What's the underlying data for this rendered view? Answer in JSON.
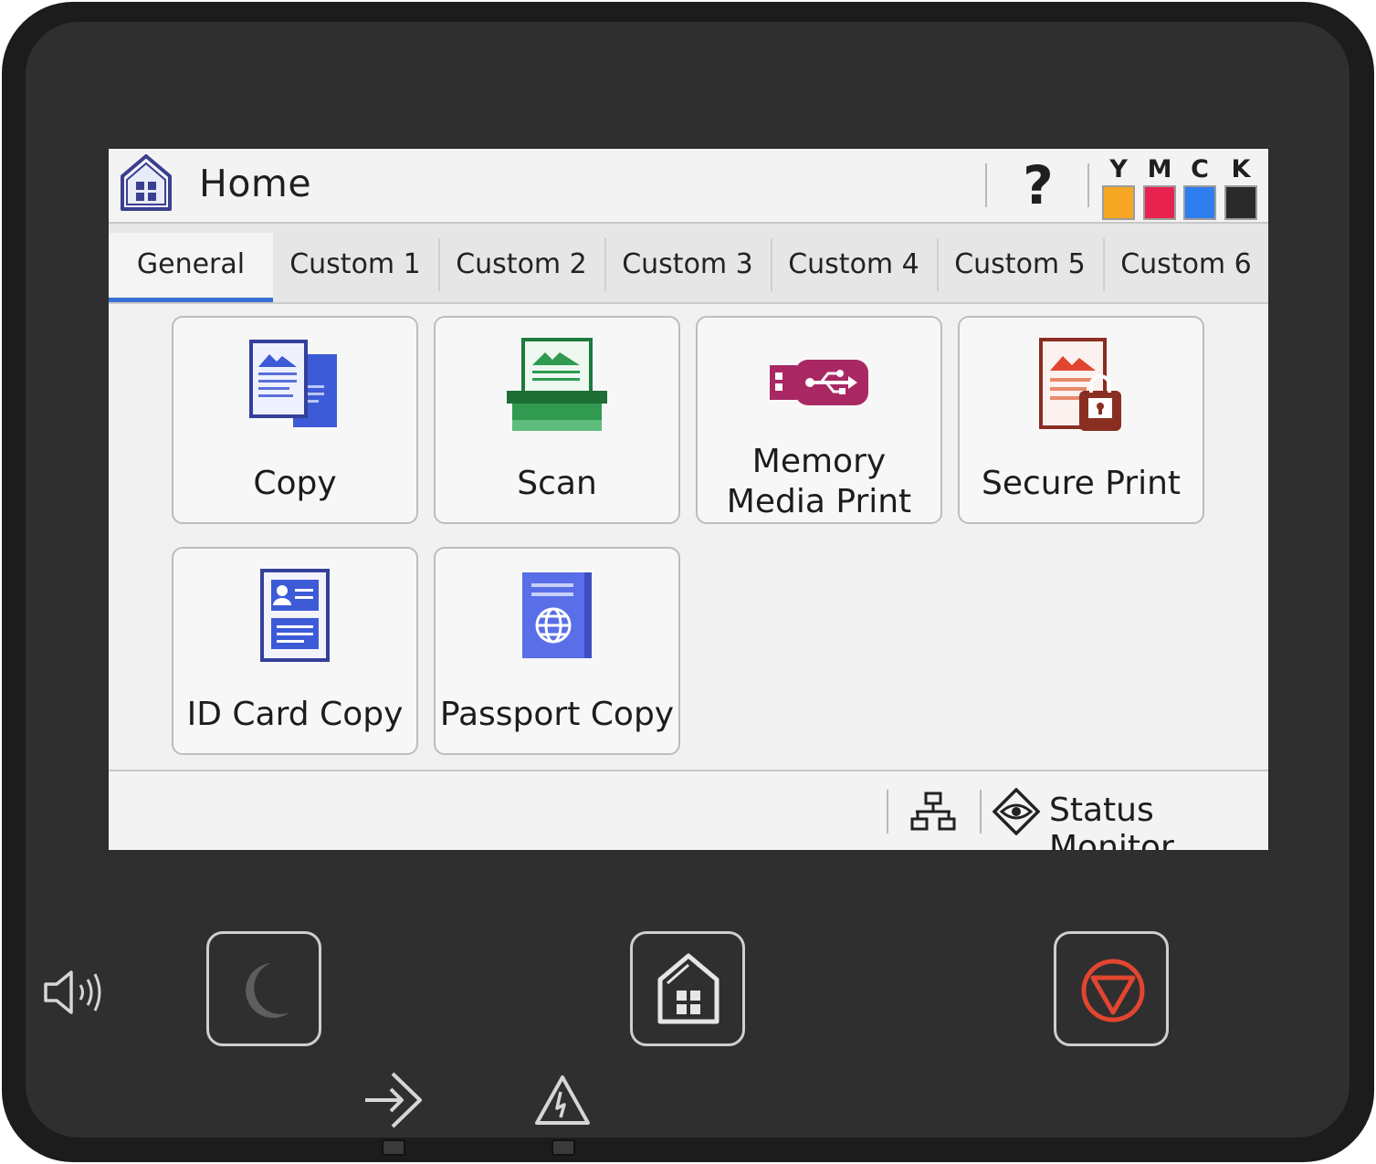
{
  "header": {
    "title": "Home",
    "help_label": "?"
  },
  "inks": [
    {
      "label": "Y",
      "color": "#f5a623"
    },
    {
      "label": "M",
      "color": "#e8224f"
    },
    {
      "label": "C",
      "color": "#2f7ef0"
    },
    {
      "label": "K",
      "color": "#2a2a2a"
    }
  ],
  "tabs": [
    {
      "label": "General",
      "active": true
    },
    {
      "label": "Custom 1"
    },
    {
      "label": "Custom 2"
    },
    {
      "label": "Custom 3"
    },
    {
      "label": "Custom 4"
    },
    {
      "label": "Custom 5"
    },
    {
      "label": "Custom 6"
    }
  ],
  "tiles": [
    {
      "label": "Copy",
      "icon": "copy-icon"
    },
    {
      "label": "Scan",
      "icon": "scan-icon"
    },
    {
      "label_line1": "Memory",
      "label_line2": "Media Print",
      "icon": "usb-drive-icon"
    },
    {
      "label": "Secure Print",
      "icon": "secure-print-icon"
    },
    {
      "label": "ID Card Copy",
      "icon": "id-card-icon"
    },
    {
      "label": "Passport Copy",
      "icon": "passport-icon"
    }
  ],
  "footer": {
    "status_monitor": "Status Monitor",
    "network_icon": "network-icon",
    "status_icon": "eye-diamond-icon"
  },
  "hardware": {
    "sleep_icon": "moon-icon",
    "home_icon": "home-icon",
    "stop_icon": "stop-icon",
    "volume_icon": "speaker-icon",
    "data_icon": "data-indicator-icon",
    "error_icon": "warning-icon"
  },
  "colors": {
    "accent": "#3a6fd8",
    "stop": "#e2452f"
  }
}
